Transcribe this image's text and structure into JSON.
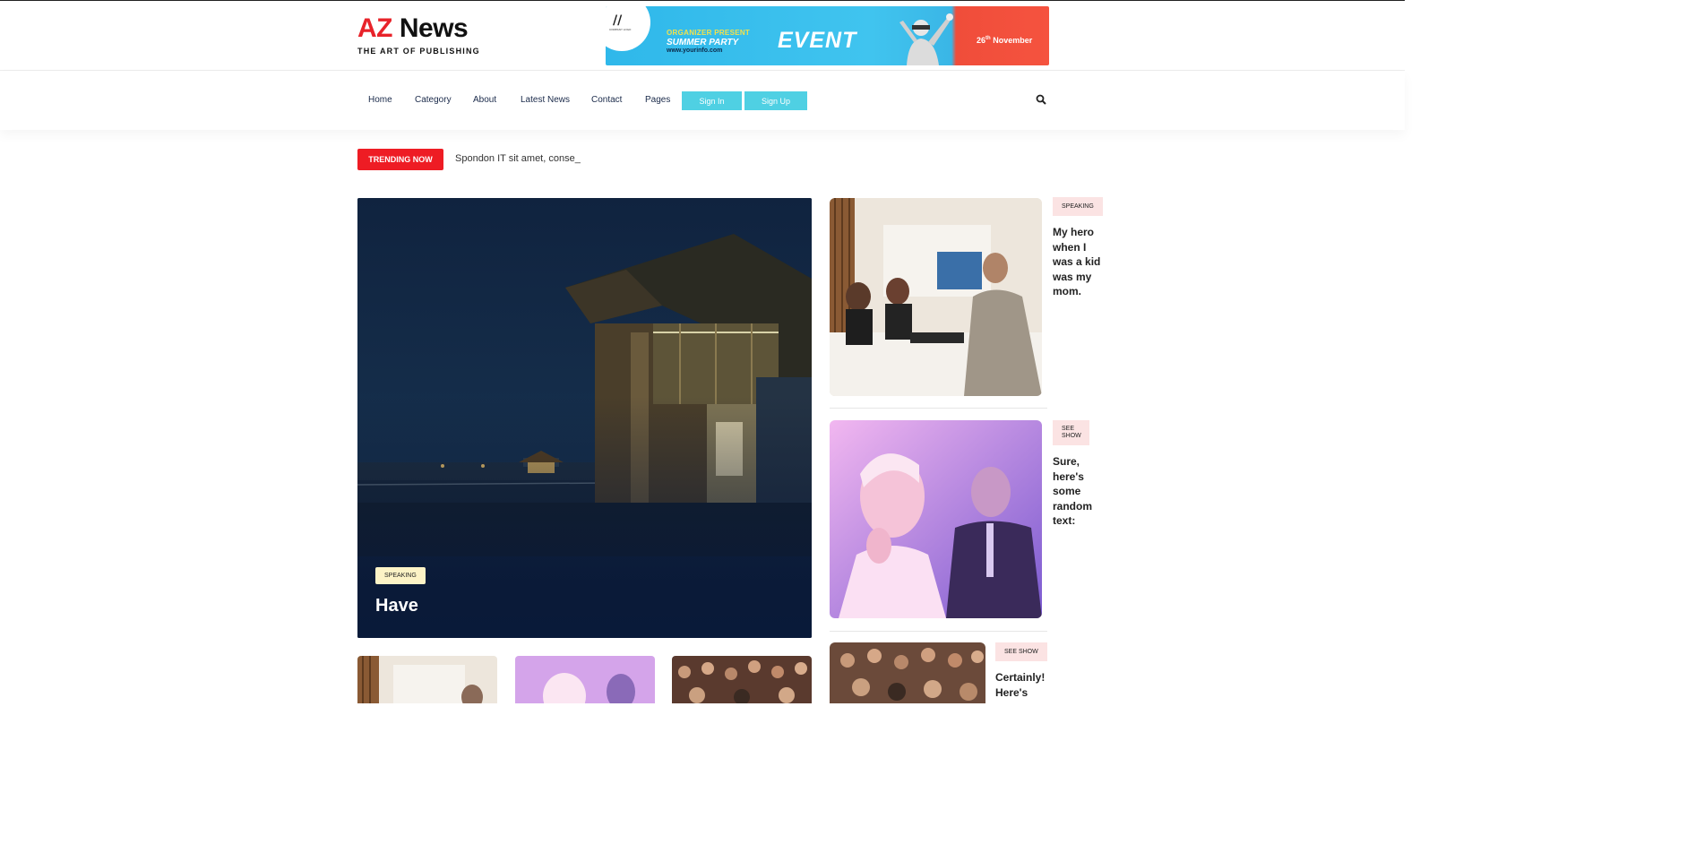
{
  "brand": {
    "logo_az": "AZ",
    "logo_news": "News",
    "tagline": "THE ART OF PUBLISHING"
  },
  "ad_banner": {
    "badge_sub": "COMPANY LOGO",
    "organizer": "ORGANIZER PRESENT",
    "party": "SUMMER PARTY",
    "url": "www.yourinfo.com",
    "event": "EVENT",
    "date_day": "26",
    "date_suffix": "th",
    "date_month": "November"
  },
  "nav": {
    "items": [
      "Home",
      "Category",
      "About",
      "Latest News",
      "Contact",
      "Pages"
    ],
    "sign_in": "Sign In",
    "sign_up": "Sign Up"
  },
  "trending": {
    "label": "TRENDING NOW",
    "text": "Spondon IT sit amet, conse_"
  },
  "hero": {
    "tag": "SPEAKING",
    "title": "Have"
  },
  "side_posts": [
    {
      "tag": "SPEAKING",
      "title": "My hero when I was a kid was my mom."
    },
    {
      "tag": "SEE SHOW",
      "title": "Sure, here's some random text:"
    },
    {
      "tag": "SEE SHOW",
      "title": "Certainly! Here's"
    }
  ],
  "colors": {
    "accent_red": "#ee1c24",
    "nav_button": "#4fd0e3",
    "tag_pink": "#fbe3e3",
    "tag_yellow": "#fdf3c6"
  }
}
